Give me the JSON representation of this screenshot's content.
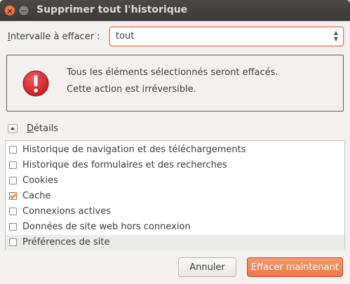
{
  "window": {
    "title": "Supprimer tout l'historique",
    "close_glyph": "×",
    "minimize_glyph": "−"
  },
  "range": {
    "label_accel": "I",
    "label_rest": "ntervalle à effacer :",
    "value": "tout"
  },
  "warning": {
    "icon": "error-icon",
    "line1": "Tous les éléments sélectionnés seront effacés.",
    "line2": "Cette action est irréversible."
  },
  "details": {
    "label_accel": "D",
    "label_rest": "étails",
    "expanded": true
  },
  "items": [
    {
      "label": "Historique de navigation et des téléchargements",
      "checked": false,
      "selected": false
    },
    {
      "label": "Historique des formulaires et des recherches",
      "checked": false,
      "selected": false
    },
    {
      "label": "Cookies",
      "checked": false,
      "selected": false
    },
    {
      "label": "Cache",
      "checked": true,
      "selected": false
    },
    {
      "label": "Connexions actives",
      "checked": false,
      "selected": false
    },
    {
      "label": "Données de site web hors connexion",
      "checked": false,
      "selected": false
    },
    {
      "label": "Préférences de site",
      "checked": false,
      "selected": true
    }
  ],
  "buttons": {
    "cancel": "Annuler",
    "confirm": "Effacer maintenant"
  },
  "colors": {
    "accent": "#e9794a",
    "error": "#d8252f"
  }
}
